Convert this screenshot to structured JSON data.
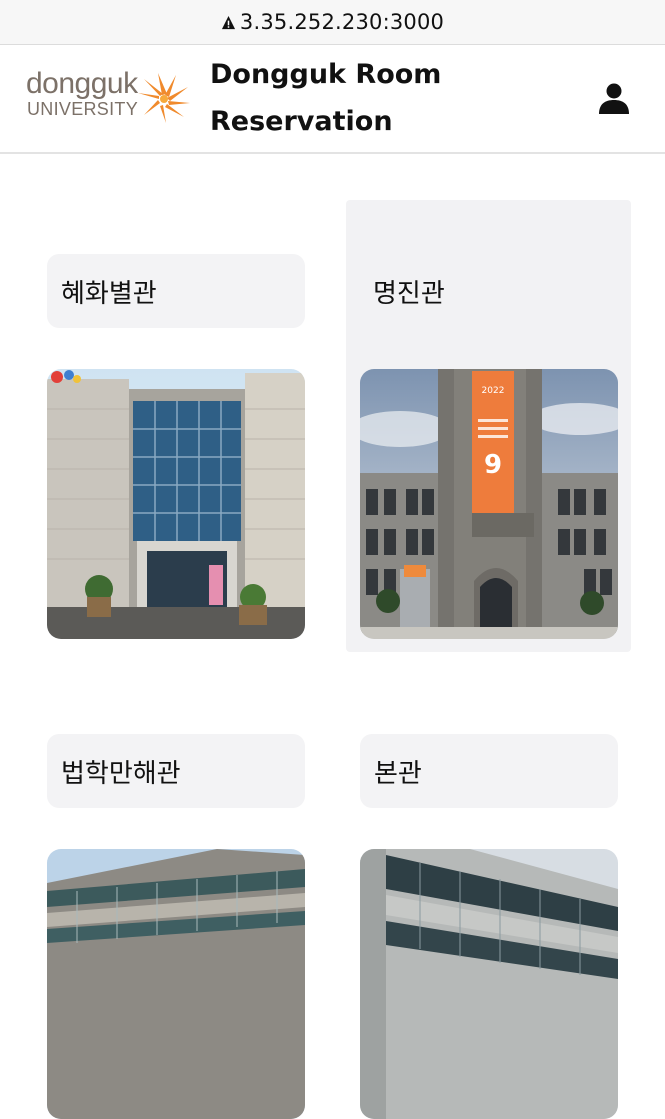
{
  "browser": {
    "url": "3.35.252.230:3000"
  },
  "header": {
    "logo_text_top": "dongguk",
    "logo_text_bottom": "UNIVERSITY",
    "title_line1": "Dongguk Room",
    "title_line2": "Reservation",
    "user_icon": "user-icon"
  },
  "buildings": [
    {
      "name": "혜화별관",
      "photo": "hyehwa-building-photo",
      "selected": false
    },
    {
      "name": "명진관",
      "photo": "myeongjin-building-photo",
      "selected": true,
      "banner_number": "9",
      "banner_year": "2022"
    },
    {
      "name": "법학만해관",
      "photo": "law-building-photo",
      "selected": false
    },
    {
      "name": "본관",
      "photo": "main-building-photo",
      "selected": false
    }
  ],
  "colors": {
    "accent_orange": "#f08a2c",
    "card_bg": "#f3f3f5",
    "selected_bg": "#f2f2f4"
  }
}
